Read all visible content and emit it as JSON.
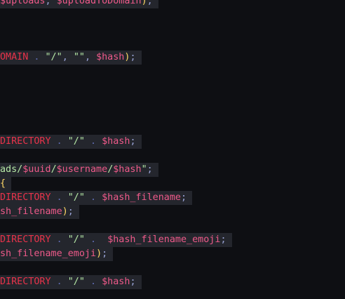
{
  "colors": {
    "background": "#0e0f13",
    "line_highlight": "#24262d",
    "constant": "#e8334a",
    "variable": "#ef5a8a",
    "string": "#b5e8a6",
    "operator": "#5e6bb0",
    "punctuation": "#9aa3d6",
    "paren": "#ffd866"
  },
  "code_lines": [
    {
      "id": "line-1",
      "tokens": [
        {
          "t": "$uploads",
          "c": "variable"
        },
        {
          "t": ", ",
          "c": "punctuation"
        },
        {
          "t": "$uploadToDomain",
          "c": "variable"
        },
        {
          "t": ")",
          "c": "paren"
        },
        {
          "t": ";",
          "c": "punctuation"
        }
      ]
    },
    {
      "id": "line-2",
      "tokens": [
        {
          "t": "OMAIN",
          "c": "constant"
        },
        {
          "t": " . ",
          "c": "operator"
        },
        {
          "t": "\"/\"",
          "c": "string"
        },
        {
          "t": ", ",
          "c": "punctuation"
        },
        {
          "t": "\"\"",
          "c": "string"
        },
        {
          "t": ", ",
          "c": "punctuation"
        },
        {
          "t": "$hash",
          "c": "variable"
        },
        {
          "t": ")",
          "c": "paren"
        },
        {
          "t": ";",
          "c": "punctuation"
        }
      ]
    },
    {
      "id": "line-3",
      "tokens": [
        {
          "t": "DIRECTORY",
          "c": "constant"
        },
        {
          "t": " . ",
          "c": "operator"
        },
        {
          "t": "\"/\"",
          "c": "string"
        },
        {
          "t": " . ",
          "c": "operator"
        },
        {
          "t": "$hash",
          "c": "variable"
        },
        {
          "t": ";",
          "c": "punctuation"
        }
      ]
    },
    {
      "id": "line-4",
      "tokens": [
        {
          "t": "ads/",
          "c": "string"
        },
        {
          "t": "$uuid",
          "c": "variable"
        },
        {
          "t": "/",
          "c": "string"
        },
        {
          "t": "$username",
          "c": "variable"
        },
        {
          "t": "/",
          "c": "string"
        },
        {
          "t": "$hash",
          "c": "variable"
        },
        {
          "t": "\"",
          "c": "string"
        },
        {
          "t": ";",
          "c": "punctuation"
        }
      ]
    },
    {
      "id": "line-5",
      "tokens": [
        {
          "t": "{",
          "c": "paren"
        }
      ]
    },
    {
      "id": "line-6",
      "tokens": [
        {
          "t": "DIRECTORY",
          "c": "constant"
        },
        {
          "t": " . ",
          "c": "operator"
        },
        {
          "t": "\"/\"",
          "c": "string"
        },
        {
          "t": " . ",
          "c": "operator"
        },
        {
          "t": "$hash_filename",
          "c": "variable"
        },
        {
          "t": ";",
          "c": "punctuation"
        }
      ]
    },
    {
      "id": "line-7",
      "tokens": [
        {
          "t": "sh_filename",
          "c": "variable"
        },
        {
          "t": ")",
          "c": "paren"
        },
        {
          "t": ";",
          "c": "punctuation"
        }
      ]
    },
    {
      "id": "line-8",
      "tokens": [
        {
          "t": "DIRECTORY",
          "c": "constant"
        },
        {
          "t": " . ",
          "c": "operator"
        },
        {
          "t": "\"/\"",
          "c": "string"
        },
        {
          "t": " .  ",
          "c": "operator"
        },
        {
          "t": "$hash_filename_emoji",
          "c": "variable"
        },
        {
          "t": ";",
          "c": "punctuation"
        }
      ]
    },
    {
      "id": "line-9",
      "tokens": [
        {
          "t": "sh_filename_emoji",
          "c": "variable"
        },
        {
          "t": ")",
          "c": "paren"
        },
        {
          "t": ";",
          "c": "punctuation"
        }
      ]
    },
    {
      "id": "line-10",
      "tokens": [
        {
          "t": "DIRECTORY",
          "c": "constant"
        },
        {
          "t": " . ",
          "c": "operator"
        },
        {
          "t": "\"/\"",
          "c": "string"
        },
        {
          "t": " . ",
          "c": "operator"
        },
        {
          "t": "$hash",
          "c": "variable"
        },
        {
          "t": ";",
          "c": "punctuation"
        }
      ]
    }
  ]
}
